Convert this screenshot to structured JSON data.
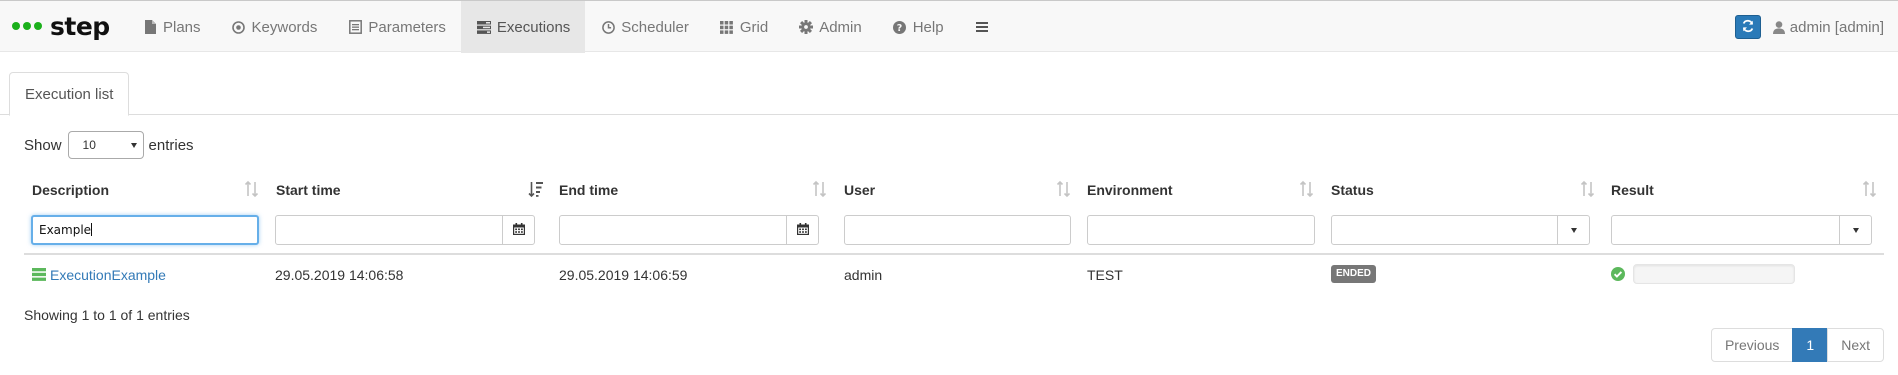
{
  "brand": {
    "name": "step",
    "dot_color": "#1bb01b"
  },
  "nav": {
    "items": [
      {
        "label": "Plans",
        "icon": "file-icon"
      },
      {
        "label": "Keywords",
        "icon": "target-icon"
      },
      {
        "label": "Parameters",
        "icon": "list-alt-icon"
      },
      {
        "label": "Executions",
        "icon": "tasks-icon",
        "active": true
      },
      {
        "label": "Scheduler",
        "icon": "clock-icon"
      },
      {
        "label": "Grid",
        "icon": "grid-icon"
      },
      {
        "label": "Admin",
        "icon": "gear-icon"
      },
      {
        "label": "Help",
        "icon": "help-icon"
      }
    ],
    "menu_icon": "hamburger-icon",
    "user_label": "admin [admin]",
    "refresh_icon": "refresh-icon",
    "accent": "#2a7ab8"
  },
  "tabs": [
    {
      "label": "Execution list",
      "active": true
    }
  ],
  "length": {
    "prefix": "Show",
    "value": "10",
    "suffix": "entries"
  },
  "table": {
    "columns": [
      {
        "label": "Description",
        "filter": "Example",
        "filter_type": "text"
      },
      {
        "label": "Start time",
        "filter": "",
        "filter_type": "date",
        "sorted": "desc"
      },
      {
        "label": "End time",
        "filter": "",
        "filter_type": "date"
      },
      {
        "label": "User",
        "filter": "",
        "filter_type": "text"
      },
      {
        "label": "Environment",
        "filter": "",
        "filter_type": "text"
      },
      {
        "label": "Status",
        "filter": "",
        "filter_type": "select"
      },
      {
        "label": "Result",
        "filter": "",
        "filter_type": "select"
      }
    ],
    "rows": [
      {
        "description": "ExecutionExample",
        "start_time": "29.05.2019 14:06:58",
        "end_time": "29.05.2019 14:06:59",
        "user": "admin",
        "environment": "TEST",
        "status": "ENDED",
        "result_icon": "check-circle-icon",
        "result_progress": 0
      }
    ]
  },
  "info": "Showing 1 to 1 of 1 entries",
  "pagination": {
    "previous": "Previous",
    "current": "1",
    "next": "Next"
  },
  "colors": {
    "link": "#337ab7",
    "passed": "#5cb85c",
    "badge": "#777777"
  }
}
